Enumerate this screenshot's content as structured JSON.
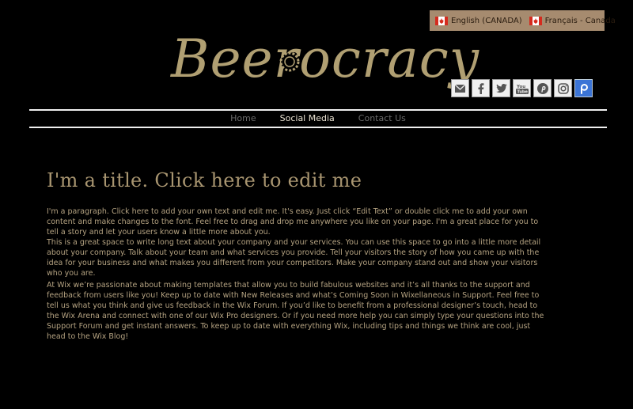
{
  "language_selector": {
    "items": [
      {
        "label": "English (CANADA)",
        "flag": "canada-flag-icon"
      },
      {
        "label": "Français - Canada",
        "flag": "canada-flag-icon"
      }
    ],
    "background": "#a68b6f"
  },
  "logo": {
    "text": "Beerocracy",
    "color": "#b09f72"
  },
  "social_icons": [
    "envelope-icon",
    "facebook-icon",
    "twitter-icon",
    "youtube-icon",
    "pinterest-icon",
    "instagram-icon",
    "patreon-icon"
  ],
  "nav": {
    "items": [
      {
        "label": "Home",
        "active": false
      },
      {
        "label": "Social Media",
        "active": true
      },
      {
        "label": "Contact Us",
        "active": false
      }
    ]
  },
  "main": {
    "title": "I'm a title. Click here to edit me",
    "paragraph1_line1": "I'm a paragraph. Click here to add your own text and edit me. It's easy. Just click “Edit Text” or double click me to add your own content and make changes to the font. Feel free to drag and drop me anywhere you like on your page. I'm a great place for you to tell a story and let your users know a little more about you.",
    "paragraph1_line2": "This is a great space to write long text about your company and your services. You can use this space to go into a little more detail about your company. Talk about your team and what services you provide. Tell your visitors the story of how you came up with the idea for your business and what makes you different from your competitors. Make your company stand out and show your visitors who you are.",
    "paragraph2": "At Wix we’re passionate about making templates that allow you to build fabulous websites and it’s all thanks to the support and feedback from users like you! Keep up to date with New Releases and what’s Coming Soon in Wixellaneous in Support. Feel free to tell us what you think and give us feedback in the Wix Forum. If you’d like to benefit from a professional designer’s touch, head to the Wix Arena and connect with one of our Wix Pro designers. Or if you need more help you can simply type your questions into the Support Forum and get instant answers. To keep up to date with everything Wix, including tips and things we think are cool, just head to the Wix Blog!"
  },
  "colors": {
    "background": "#000000",
    "accent": "#a89570",
    "text": "#b4a281"
  }
}
